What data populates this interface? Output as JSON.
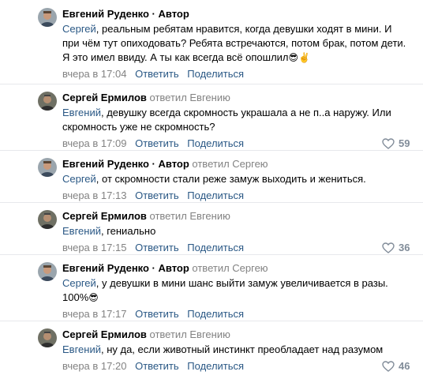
{
  "colors": {
    "link": "#2a5885",
    "meta": "#828282",
    "separator": "#e7e8ec"
  },
  "icons": {
    "like": "heart-outline-icon",
    "emoji_sunglasses": "😎",
    "emoji_victory": "✌️"
  },
  "comments": [
    {
      "author": "Евгений Руденко · Автор",
      "replied_to": "",
      "mention": "Сергей",
      "text": ", реальным ребятам нравится, когда девушки ходят в мини. И при чём тут опиходовать? Ребята встречаются, потом брак, потом дети. Я это имел ввиду. А ты как всегда всё опошлил",
      "emoji": "😎✌️",
      "time": "вчера в 17:04",
      "reply_label": "Ответить",
      "share_label": "Поделиться",
      "likes": ""
    },
    {
      "author": "Сергей Ермилов",
      "replied_to": "ответил Евгению",
      "mention": "Евгений",
      "text": ", девушку всегда скромность украшала а не п..а наружу. Или скромность уже не скромность?",
      "emoji": "",
      "time": "вчера в 17:09",
      "reply_label": "Ответить",
      "share_label": "Поделиться",
      "likes": "59"
    },
    {
      "author": "Евгений Руденко · Автор",
      "replied_to": "ответил Сергею",
      "mention": "Сергей",
      "text": ", от скромности стали реже замуж выходить и жениться.",
      "emoji": "",
      "time": "вчера в 17:13",
      "reply_label": "Ответить",
      "share_label": "Поделиться",
      "likes": ""
    },
    {
      "author": "Сергей Ермилов",
      "replied_to": "ответил Евгению",
      "mention": "Евгений",
      "text": ", гениально",
      "emoji": "",
      "time": "вчера в 17:15",
      "reply_label": "Ответить",
      "share_label": "Поделиться",
      "likes": "36"
    },
    {
      "author": "Евгений Руденко · Автор",
      "replied_to": "ответил Сергею",
      "mention": "Сергей",
      "text": ", у девушки в мини шанс выйти замуж увеличивается в разы. 100%",
      "emoji": "😎",
      "time": "вчера в 17:17",
      "reply_label": "Ответить",
      "share_label": "Поделиться",
      "likes": ""
    },
    {
      "author": "Сергей Ермилов",
      "replied_to": "ответил Евгению",
      "mention": "Евгений",
      "text": ", ну да, если животный инстинкт преобладает над разумом",
      "emoji": "",
      "time": "вчера в 17:20",
      "reply_label": "Ответить",
      "share_label": "Поделиться",
      "likes": "46"
    }
  ]
}
